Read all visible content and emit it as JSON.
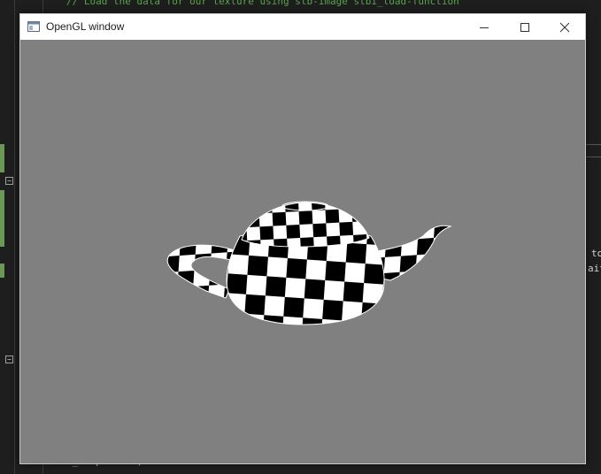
{
  "editor": {
    "top_comment": "// Load the data for our texture using stb-image stbi_load-function",
    "bottom_code": "m_teapot = 0;",
    "right_fragment_1": "to",
    "right_fragment_2": "ait",
    "fold_symbol": "−",
    "colors": {
      "background": "#1e1e1e",
      "comment": "#57a64a",
      "change_bar": "#6a9955"
    }
  },
  "window": {
    "title": "OpenGL window",
    "icons": {
      "app": "app-window-icon",
      "minimize": "minimize-icon",
      "maximize": "maximize-icon",
      "close": "close-icon"
    },
    "clear_color": "#808080"
  },
  "scene": {
    "object": "teapot",
    "texture": "checkerboard",
    "texture_colors": [
      "#000000",
      "#ffffff"
    ]
  }
}
